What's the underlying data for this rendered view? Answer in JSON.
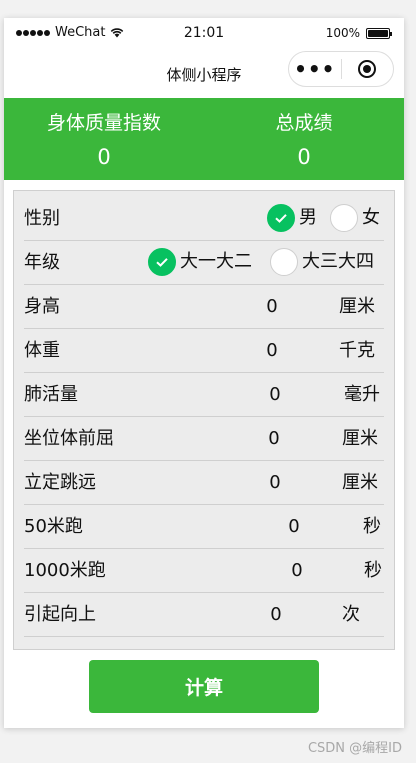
{
  "status_bar": {
    "carrier": "WeChat",
    "time": "21:01",
    "battery": "100%"
  },
  "nav": {
    "title": "体侧小程序",
    "more_label": "•••"
  },
  "summary": {
    "bmi_label": "身体质量指数",
    "bmi_value": "0",
    "score_label": "总成绩",
    "score_value": "0"
  },
  "form": {
    "gender": {
      "label": "性别",
      "options": [
        "男",
        "女"
      ],
      "selected": "男"
    },
    "grade": {
      "label": "年级",
      "options": [
        "大一大二",
        "大三大四"
      ],
      "selected": "大一大二"
    },
    "rows": [
      {
        "label": "身高",
        "value": "0",
        "unit": "厘米"
      },
      {
        "label": "体重",
        "value": "0",
        "unit": "千克"
      },
      {
        "label": "肺活量",
        "value": "0",
        "unit": "毫升"
      },
      {
        "label": "坐位体前屈",
        "value": "0",
        "unit": "厘米"
      },
      {
        "label": "立定跳远",
        "value": "0",
        "unit": "厘米"
      },
      {
        "label": "50米跑",
        "value": "0",
        "unit": "秒"
      },
      {
        "label": "1000米跑",
        "value": "0",
        "unit": "秒"
      },
      {
        "label": "引起向上",
        "value": "0",
        "unit": "次"
      }
    ]
  },
  "actions": {
    "calculate_label": "计算"
  },
  "watermark": "CSDN @编程ID",
  "colors": {
    "accent_green": "#3bb73b",
    "radio_green": "#07c160"
  }
}
